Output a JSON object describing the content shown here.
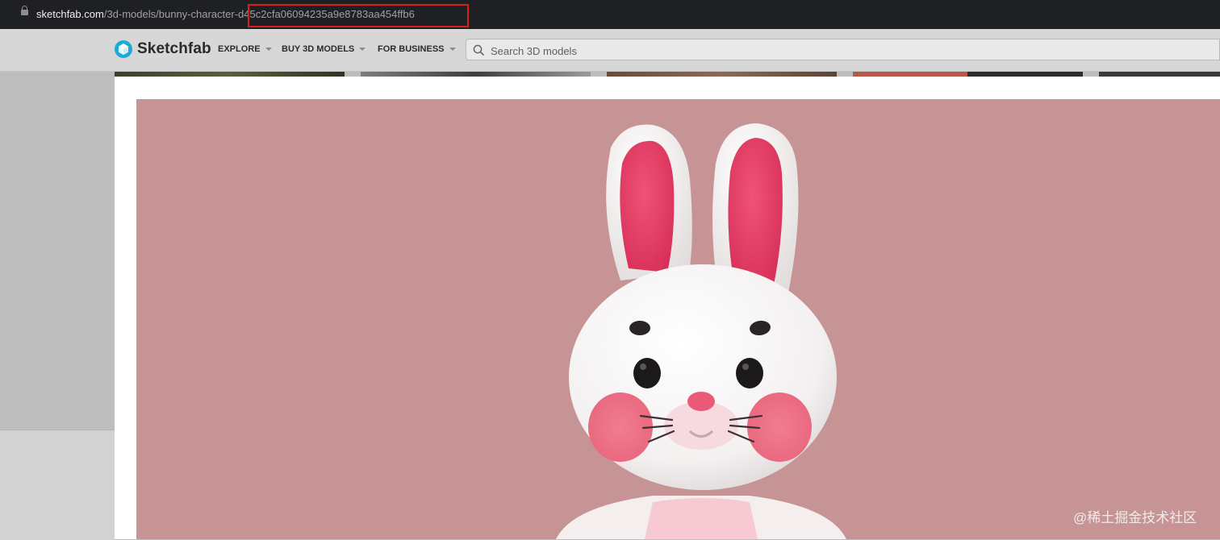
{
  "browser": {
    "url_host": "sketchfab.com",
    "url_path": "/3d-models/bunny-character",
    "url_hash": "-d45c2cfa06094235a9e8783aa454ffb6"
  },
  "header": {
    "brand": "Sketchfab",
    "nav": [
      {
        "label": "EXPLORE"
      },
      {
        "label": "BUY 3D MODELS"
      },
      {
        "label": "FOR BUSINESS"
      }
    ],
    "search_placeholder": "Search 3D models"
  },
  "watermark": "@稀土掘金技术社区",
  "colors": {
    "viewer_bg": "#c69495",
    "accent_highlight": "#d81f1f",
    "brand_blue": "#1caad9"
  }
}
